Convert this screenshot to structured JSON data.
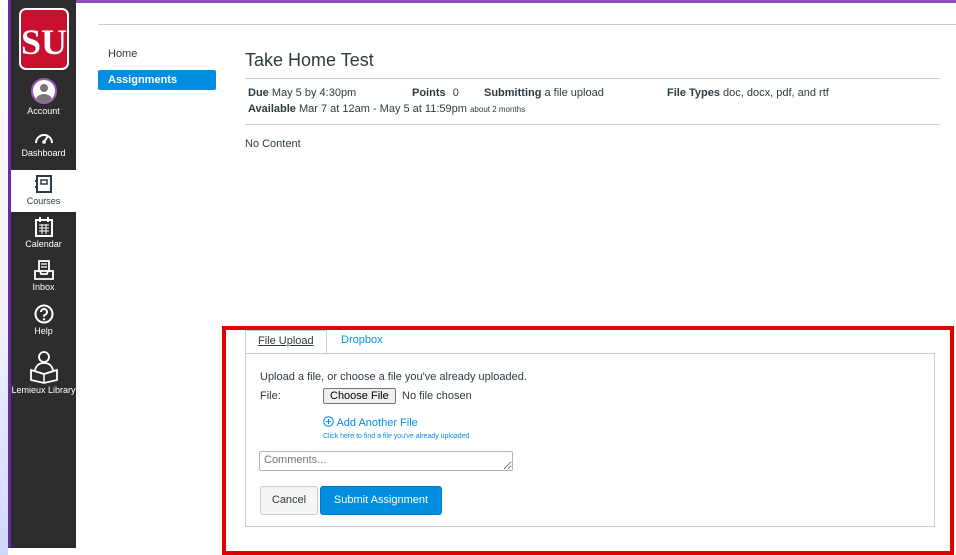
{
  "global_nav": {
    "items": [
      {
        "key": "account",
        "label": "Account",
        "icon": "avatar"
      },
      {
        "key": "dashboard",
        "label": "Dashboard",
        "icon": "dashboard-icon"
      },
      {
        "key": "courses",
        "label": "Courses",
        "icon": "courses-icon"
      },
      {
        "key": "calendar",
        "label": "Calendar",
        "icon": "calendar-icon"
      },
      {
        "key": "inbox",
        "label": "Inbox",
        "icon": "inbox-icon"
      },
      {
        "key": "help",
        "label": "Help",
        "icon": "help-icon"
      },
      {
        "key": "library",
        "label": "Lemieux Library",
        "icon": "library-icon"
      }
    ],
    "logo_text": "SU",
    "colors": {
      "nav_bg": "#2d2d2d",
      "accent": "#008ee2",
      "logo_red": "#c8102e"
    }
  },
  "course_nav": {
    "items": [
      {
        "label": "Home",
        "active": false
      },
      {
        "label": "Assignments",
        "active": true
      }
    ]
  },
  "assignment": {
    "title": "Take Home Test",
    "due_label": "Due",
    "due_value": "May 5 by 4:30pm",
    "points_label": "Points",
    "points_value": "0",
    "submitting_label": "Submitting",
    "submitting_value": "a file upload",
    "filetypes_label": "File Types",
    "filetypes_value": "doc, docx, pdf, and rtf",
    "available_label": "Available",
    "available_value": "Mar 7 at 12am - May 5 at 11:59pm",
    "available_note": "about 2 months",
    "body": "No Content"
  },
  "submission": {
    "tabs": [
      "File Upload",
      "Dropbox"
    ],
    "instructions": "Upload a file, or choose a file you've already uploaded.",
    "file_label": "File:",
    "choose_file_button": "Choose File",
    "no_file_text": "No file chosen",
    "add_another_file": "Add Another File",
    "find_uploaded": "Click here to find a file you've already uploaded",
    "comments_placeholder": "Comments...",
    "cancel_button": "Cancel",
    "submit_button": "Submit Assignment"
  }
}
